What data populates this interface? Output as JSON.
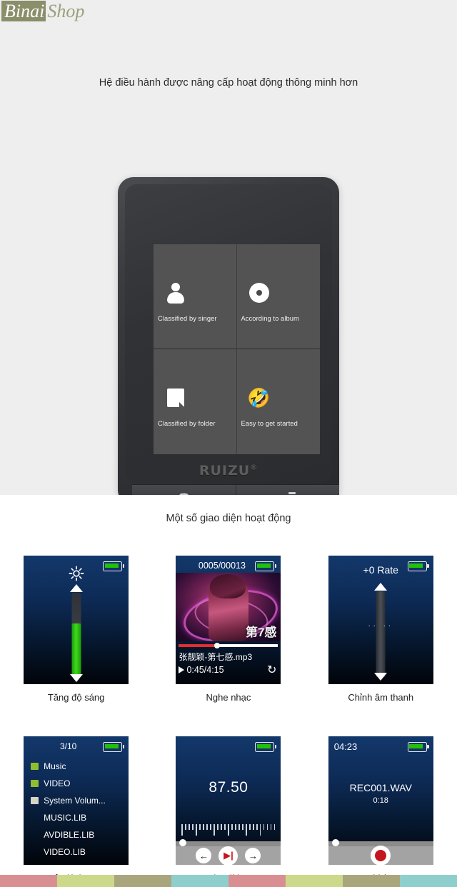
{
  "site": {
    "logo_part1": "Binai",
    "logo_part2": "Shop",
    "logo_bg": "#8a8f6a",
    "logo_fg": "#9aa07b"
  },
  "headline": "Hệ điều hành được nâng cấp hoạt động thông minh hơn",
  "subhead": "Một số giao diện hoạt động",
  "device": {
    "brand": "RUIZU",
    "brand_mark": "®",
    "menu_tiles": [
      {
        "icon": "person-icon",
        "label": "Classified by singer"
      },
      {
        "icon": "disc-icon",
        "label": "According to album"
      },
      {
        "icon": "folder-icon",
        "label": "Classified by folder"
      },
      {
        "icon": "smiley-icon",
        "label": "Easy to get started",
        "glyph": "🤣"
      }
    ],
    "buttons": [
      {
        "icon": "back-icon",
        "name": "back-button"
      },
      {
        "icon": "menu-icon",
        "name": "menu-button"
      }
    ]
  },
  "screens": [
    {
      "id": "brightness",
      "caption": "Tăng độ sáng",
      "battery": "full",
      "slider_fill_color": "#2cc40f",
      "slider_track_color": "#3a3f47"
    },
    {
      "id": "music",
      "caption": "Nghe nhạc",
      "track_index": "0005/00013",
      "album_text": "第7感",
      "title": "张靓颖-第七感.mp3",
      "time": "0:45/4:15",
      "progress_percent": 39,
      "loop_icon": "↻",
      "play_icon": "play-icon"
    },
    {
      "id": "sound",
      "caption": "Chỉnh âm thanh",
      "rate_label": "+0 Rate",
      "dots": ".. .."
    },
    {
      "id": "folder",
      "caption": "Quản lý thư mục",
      "counter": "3/10",
      "items": [
        {
          "label": "Music",
          "icon": "folder-green"
        },
        {
          "label": "VIDEO",
          "icon": "folder-green"
        },
        {
          "label": "System Volum...",
          "icon": "folder-white"
        },
        {
          "label": "MUSIC.LIB",
          "icon": "none"
        },
        {
          "label": "AVDIBLE.LIB",
          "icon": "none"
        },
        {
          "label": "VIDEO.LIB",
          "icon": "none"
        }
      ]
    },
    {
      "id": "fm",
      "caption": "Nghe đài FM",
      "frequency": "87.50",
      "controls": [
        {
          "name": "prev-button",
          "glyph": "←"
        },
        {
          "name": "scan-button",
          "glyph": "▶|"
        },
        {
          "name": "next-button",
          "glyph": "→"
        }
      ]
    },
    {
      "id": "recorder",
      "caption": "Ghi âm",
      "clock": "04:23",
      "filename": "REC001.WAV",
      "duration": "0:18",
      "record_button": "record-button"
    }
  ],
  "footer_colors": [
    "#d98f92",
    "#cdd98a",
    "#a9a67e",
    "#8ecfcd",
    "#d98f92",
    "#cdd98a",
    "#a9a67e",
    "#8ecfcd"
  ]
}
